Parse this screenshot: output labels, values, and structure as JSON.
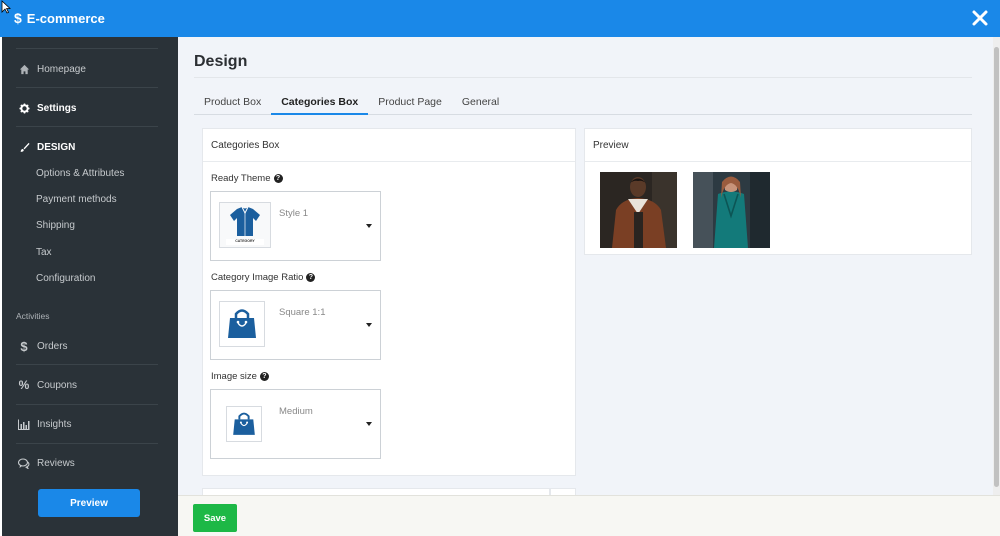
{
  "app": {
    "title": "E-commerce"
  },
  "sidebar": {
    "items": [
      {
        "label": "Homepage",
        "icon": "home-icon"
      },
      {
        "label": "Settings",
        "icon": "gear-icon"
      },
      {
        "label": "DESIGN",
        "icon": "brush-icon"
      }
    ],
    "design_subitems": [
      "Options & Attributes",
      "Payment methods",
      "Shipping",
      "Tax",
      "Configuration"
    ],
    "section_label": "Activities",
    "activities": [
      {
        "label": "Orders",
        "icon": "dollar-icon"
      },
      {
        "label": "Coupons",
        "icon": "percent-icon"
      },
      {
        "label": "Insights",
        "icon": "chart-icon"
      },
      {
        "label": "Reviews",
        "icon": "chat-icon"
      }
    ],
    "preview_button": "Preview"
  },
  "main": {
    "page_title": "Design",
    "tabs": [
      {
        "label": "Product Box",
        "active": false
      },
      {
        "label": "Categories Box",
        "active": true
      },
      {
        "label": "Product Page",
        "active": false
      },
      {
        "label": "General",
        "active": false
      }
    ],
    "categories_card": {
      "title": "Categories Box",
      "fields": [
        {
          "label": "Ready Theme",
          "value": "Style 1",
          "thumb_caption": "CATEGORY"
        },
        {
          "label": "Category Image Ratio",
          "value": "Square 1:1"
        },
        {
          "label": "Image size",
          "value": "Medium"
        }
      ]
    },
    "preview_card": {
      "title": "Preview"
    }
  },
  "footer": {
    "save_label": "Save"
  },
  "colors": {
    "accent": "#1a88e8",
    "sidebar_bg": "#2a3238",
    "save_green": "#1db846",
    "icon_blue": "#1b5f9e"
  }
}
